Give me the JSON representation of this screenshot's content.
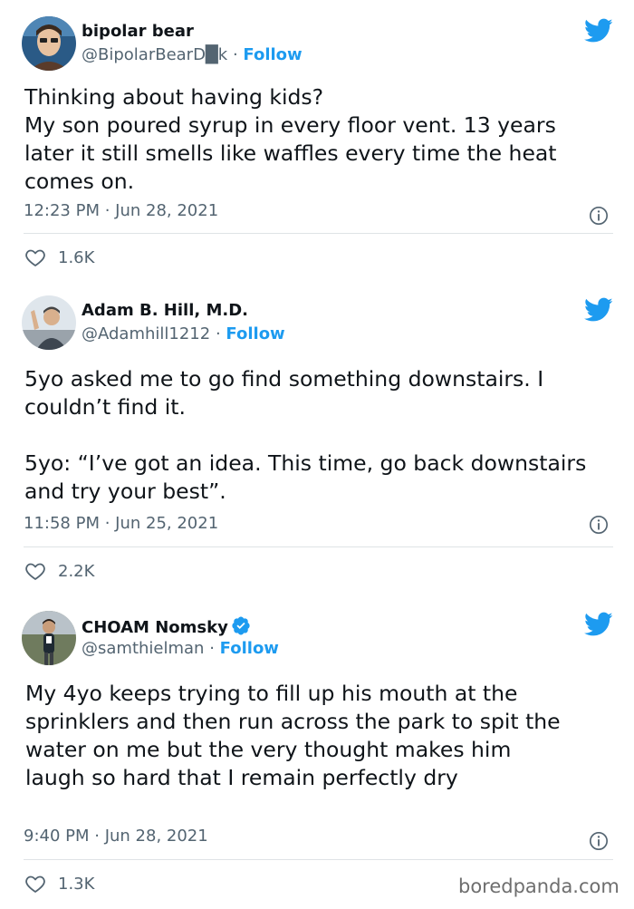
{
  "tweets": [
    {
      "name": "bipolar bear",
      "handle": "@BipolarBearD█k",
      "separator": "·",
      "follow": "Follow",
      "text": "Thinking about having kids?\nMy son poured syrup in every floor vent. 13 years later it still smells like waffles every time the heat comes on.",
      "time": "12:23 PM · Jun 28, 2021",
      "likes": "1.6K",
      "verified": false
    },
    {
      "name": "Adam B. Hill, M.D.",
      "handle": "@Adamhill1212",
      "separator": "·",
      "follow": "Follow",
      "text": "5yo asked me to go find something downstairs. I couldn’t find it.\n\n5yo: “I’ve got an idea. This time, go back downstairs and try your best”.",
      "time": "11:58 PM · Jun 25, 2021",
      "likes": "2.2K",
      "verified": false
    },
    {
      "name": "CHOAM Nomsky",
      "handle": "@samthielman",
      "separator": "·",
      "follow": "Follow",
      "text": "My 4yo keeps trying to fill up his mouth at the sprinklers and then run across the park to spit the water on me but the very thought makes him laugh so hard that I remain perfectly dry",
      "time": "9:40 PM · Jun 28, 2021",
      "likes": "1.3K",
      "verified": true
    }
  ],
  "watermark": "boredpanda.com",
  "colors": {
    "accent": "#1d9bf0",
    "text": "#0f1419",
    "muted": "#536471",
    "border": "#e1e8ed"
  }
}
